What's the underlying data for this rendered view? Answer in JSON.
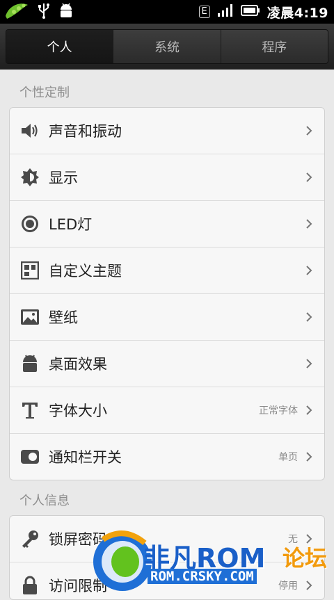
{
  "status_bar": {
    "network_badge": "E",
    "time": "凌晨4:19"
  },
  "tabs": [
    {
      "label": "个人",
      "active": true
    },
    {
      "label": "系统",
      "active": false
    },
    {
      "label": "程序",
      "active": false
    }
  ],
  "sections": [
    {
      "title": "个性定制",
      "items": [
        {
          "icon": "speaker-icon",
          "label": "声音和振动",
          "value": ""
        },
        {
          "icon": "brightness-icon",
          "label": "显示",
          "value": ""
        },
        {
          "icon": "led-icon",
          "label": "LED灯",
          "value": ""
        },
        {
          "icon": "theme-grid-icon",
          "label": "自定义主题",
          "value": ""
        },
        {
          "icon": "wallpaper-icon",
          "label": "壁纸",
          "value": ""
        },
        {
          "icon": "android-icon",
          "label": "桌面效果",
          "value": ""
        },
        {
          "icon": "font-t-icon",
          "label": "字体大小",
          "value": "正常字体"
        },
        {
          "icon": "toggle-icon",
          "label": "通知栏开关",
          "value": "单页"
        }
      ]
    },
    {
      "title": "个人信息",
      "items": [
        {
          "icon": "key-icon",
          "label": "锁屏密码",
          "value": "无"
        },
        {
          "icon": "lock-icon",
          "label": "访问限制",
          "value": "停用"
        }
      ]
    }
  ],
  "watermark": {
    "brand": "非凡ROM",
    "suffix": "论坛",
    "url": "ROM.CRSKY.COM"
  },
  "colors": {
    "background": "#e9e9e9",
    "card": "#f7f7f7",
    "section_title": "#8c8c8c",
    "status_bar": "#000000"
  }
}
